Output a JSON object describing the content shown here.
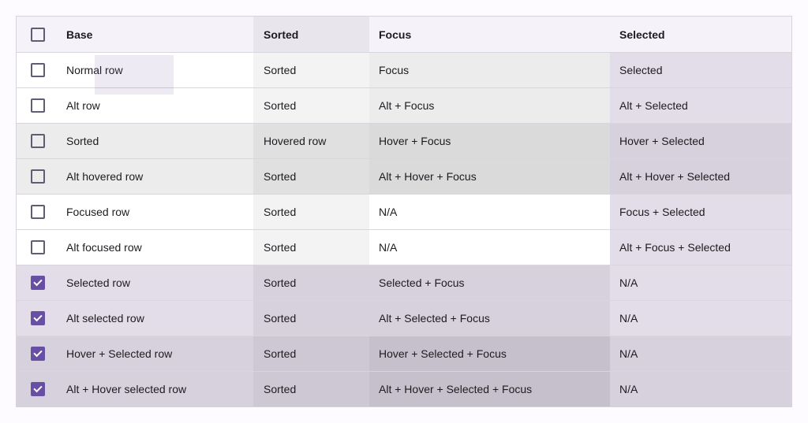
{
  "colors": {
    "white": "#ffffff",
    "sorted_light": "#f3f3f3",
    "grey_1": "#ececec",
    "grey_2": "#e0e0e0",
    "grey_3": "#dadada",
    "purple_1": "#e2dde8",
    "purple_2": "#d6d1dd",
    "purple_3": "#cdc8d3",
    "purple_4": "#c6c0cc",
    "header_bg": "#f5f2f9",
    "header_sorted_bg": "#e8e5ec",
    "check_accent": "#6750a4"
  },
  "header": {
    "base": "Base",
    "sorted": "Sorted",
    "focus": "Focus",
    "selected": "Selected"
  },
  "rows": [
    {
      "checked": false,
      "base": "Normal row",
      "sorted": "Sorted",
      "focus": "Focus",
      "selected": "Selected",
      "bg": [
        "#ffffff",
        "#f3f3f3",
        "#ececec",
        "#e2dde8"
      ]
    },
    {
      "checked": false,
      "base": "Alt row",
      "sorted": "Sorted",
      "focus": "Alt + Focus",
      "selected": "Alt + Selected",
      "bg": [
        "#ffffff",
        "#f3f3f3",
        "#ececec",
        "#e2dde8"
      ]
    },
    {
      "checked": false,
      "base": "Sorted",
      "sorted": "Hovered row",
      "focus": "Hover + Focus",
      "selected": "Hover + Selected",
      "bg": [
        "#ececec",
        "#e0e0e0",
        "#dadada",
        "#d6d1dd"
      ]
    },
    {
      "checked": false,
      "base": "Alt hovered row",
      "sorted": "Sorted",
      "focus": "Alt + Hover + Focus",
      "selected": "Alt + Hover + Selected",
      "bg": [
        "#ececec",
        "#e0e0e0",
        "#dadada",
        "#d6d1dd"
      ]
    },
    {
      "checked": false,
      "base": "Focused row",
      "sorted": "Sorted",
      "focus": "N/A",
      "selected": "Focus + Selected",
      "bg": [
        "#ffffff",
        "#f3f3f3",
        "#ffffff",
        "#e2dde8"
      ]
    },
    {
      "checked": false,
      "base": "Alt focused row",
      "sorted": "Sorted",
      "focus": "N/A",
      "selected": "Alt + Focus + Selected",
      "bg": [
        "#ffffff",
        "#f3f3f3",
        "#ffffff",
        "#e2dde8"
      ]
    },
    {
      "checked": true,
      "base": "Selected row",
      "sorted": "Sorted",
      "focus": "Selected + Focus",
      "selected": "N/A",
      "bg": [
        "#e2dde8",
        "#d6d1dd",
        "#d6d1dd",
        "#e2dde8"
      ]
    },
    {
      "checked": true,
      "base": "Alt selected row",
      "sorted": "Sorted",
      "focus": "Alt + Selected + Focus",
      "selected": "N/A",
      "bg": [
        "#e2dde8",
        "#d6d1dd",
        "#d6d1dd",
        "#e2dde8"
      ]
    },
    {
      "checked": true,
      "base": "Hover + Selected row",
      "sorted": "Sorted",
      "focus": "Hover + Selected + Focus",
      "selected": "N/A",
      "bg": [
        "#d6d1dd",
        "#cdc8d3",
        "#c6c0cc",
        "#d6d1dd"
      ]
    },
    {
      "checked": true,
      "base": "Alt + Hover selected row",
      "sorted": "Sorted",
      "focus": "Alt + Hover + Selected + Focus",
      "selected": "N/A",
      "bg": [
        "#d6d1dd",
        "#cdc8d3",
        "#c6c0cc",
        "#d6d1dd"
      ]
    }
  ]
}
